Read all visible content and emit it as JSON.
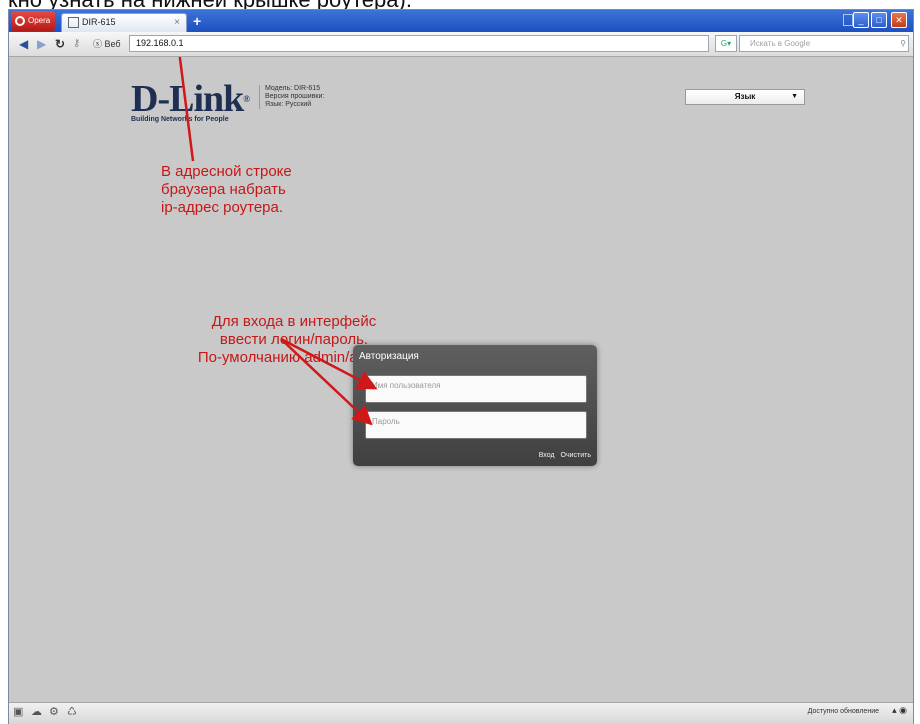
{
  "caption": "кно узнать на нижней крышке роутера).",
  "browser": {
    "app_name": "Opera",
    "tab_title": "DIR-615",
    "tab_close": "×",
    "new_tab": "+",
    "web_label": "Веб",
    "address": "192.168.0.1",
    "search_placeholder": "Искать в Google",
    "status_text": "Доступно обновление"
  },
  "router": {
    "brand": "D-Link",
    "tagline": "Building Networks for People",
    "model": "Модель: DIR-615",
    "firmware": "Версия прошивки:",
    "language_info": "Язык: Русский",
    "language_select": "Язык"
  },
  "annotations": {
    "address_hint_1": "В адресной строке",
    "address_hint_2": "браузера набрать",
    "address_hint_3": "ip-адрес роутера.",
    "login_hint_1": "Для входа в интерфейс",
    "login_hint_2": "ввести логин/пароль.",
    "login_hint_3": "По-умолчанию admin/admin"
  },
  "auth": {
    "title": "Авторизация",
    "username_placeholder": "Имя пользователя",
    "password_placeholder": "Пароль",
    "login_button": "Вход",
    "clear_button": "Очистить"
  },
  "colors": {
    "annotation": "#c61818",
    "page_bg": "#c9c9c9",
    "dialog_bg": "#4d4d4d"
  }
}
